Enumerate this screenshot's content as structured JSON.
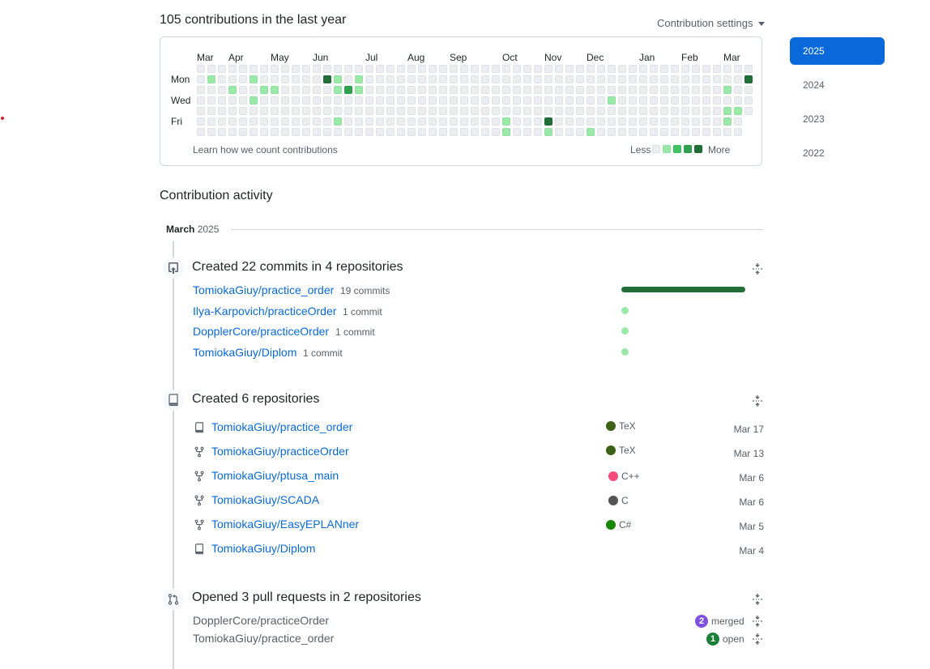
{
  "calendar": {
    "title": "105 contributions in the last year",
    "settings_label": "Contribution settings",
    "months": [
      "Mar",
      "Apr",
      "May",
      "Jun",
      "Jul",
      "Aug",
      "Sep",
      "Oct",
      "Nov",
      "Dec",
      "Jan",
      "Feb",
      "Mar"
    ],
    "weekdays": [
      "Mon",
      "Wed",
      "Fri"
    ],
    "learn_link": "Learn how we count contributions",
    "legend_less": "Less",
    "legend_more": "More",
    "colors": [
      "#ebedf0",
      "#9be9a8",
      "#40c463",
      "#30a14e",
      "#216e39"
    ],
    "active_cells": [
      [
        1,
        1,
        1
      ],
      [
        3,
        2,
        1
      ],
      [
        5,
        1,
        1
      ],
      [
        5,
        3,
        1
      ],
      [
        6,
        2,
        1
      ],
      [
        7,
        2,
        1
      ],
      [
        12,
        1,
        4
      ],
      [
        13,
        1,
        1
      ],
      [
        13,
        2,
        1
      ],
      [
        13,
        5,
        1
      ],
      [
        14,
        2,
        3
      ],
      [
        15,
        1,
        1
      ],
      [
        15,
        2,
        1
      ],
      [
        29,
        5,
        1
      ],
      [
        29,
        6,
        1
      ],
      [
        33,
        5,
        4
      ],
      [
        33,
        6,
        1
      ],
      [
        37,
        6,
        1
      ],
      [
        39,
        3,
        1
      ],
      [
        50,
        2,
        1
      ],
      [
        50,
        4,
        1
      ],
      [
        50,
        5,
        1
      ],
      [
        51,
        4,
        1
      ],
      [
        52,
        1,
        4
      ]
    ]
  },
  "years": [
    "2025",
    "2024",
    "2023",
    "2022"
  ],
  "activity": {
    "title": "Contribution activity",
    "month_label": "March",
    "month_year": "2025",
    "commits": {
      "title": "Created 22 commits in 4 repositories",
      "repos": [
        {
          "name": "TomiokaGiuy/practice_order",
          "count": "19 commits",
          "value": 19
        },
        {
          "name": "Ilya-Karpovich/practiceOrder",
          "count": "1 commit",
          "value": 1
        },
        {
          "name": "DopplerCore/practiceOrder",
          "count": "1 commit",
          "value": 1
        },
        {
          "name": "TomiokaGiuy/Diplom",
          "count": "1 commit",
          "value": 1
        }
      ]
    },
    "repos_created": {
      "title": "Created 6 repositories",
      "repos": [
        {
          "name": "TomiokaGiuy/practice_order",
          "icon": "repo-icon",
          "lang": "TeX",
          "lang_color": "#3d6117",
          "date": "Mar 17"
        },
        {
          "name": "TomiokaGiuy/practiceOrder",
          "icon": "fork-icon",
          "lang": "TeX",
          "lang_color": "#3d6117",
          "date": "Mar 13"
        },
        {
          "name": "TomiokaGiuy/ptusa_main",
          "icon": "fork-icon",
          "lang": "C++",
          "lang_color": "#f34b7d",
          "date": "Mar 6"
        },
        {
          "name": "TomiokaGiuy/SCADA",
          "icon": "fork-icon",
          "lang": "C",
          "lang_color": "#555555",
          "date": "Mar 6"
        },
        {
          "name": "TomiokaGiuy/EasyEPLANner",
          "icon": "fork-icon",
          "lang": "C#",
          "lang_color": "#178600",
          "date": "Mar 5"
        },
        {
          "name": "TomiokaGiuy/Diplom",
          "icon": "repo-icon",
          "lang": "",
          "lang_color": "",
          "date": "Mar 4"
        }
      ]
    },
    "pull_requests": {
      "title": "Opened 3 pull requests in 2 repositories",
      "repos": [
        {
          "name": "DopplerCore/practiceOrder",
          "count": "2",
          "state": "merged",
          "badge_color": "#8250df"
        },
        {
          "name": "TomiokaGiuy/practice_order",
          "count": "1",
          "state": "open",
          "badge_color": "#1a7f37"
        }
      ]
    }
  }
}
